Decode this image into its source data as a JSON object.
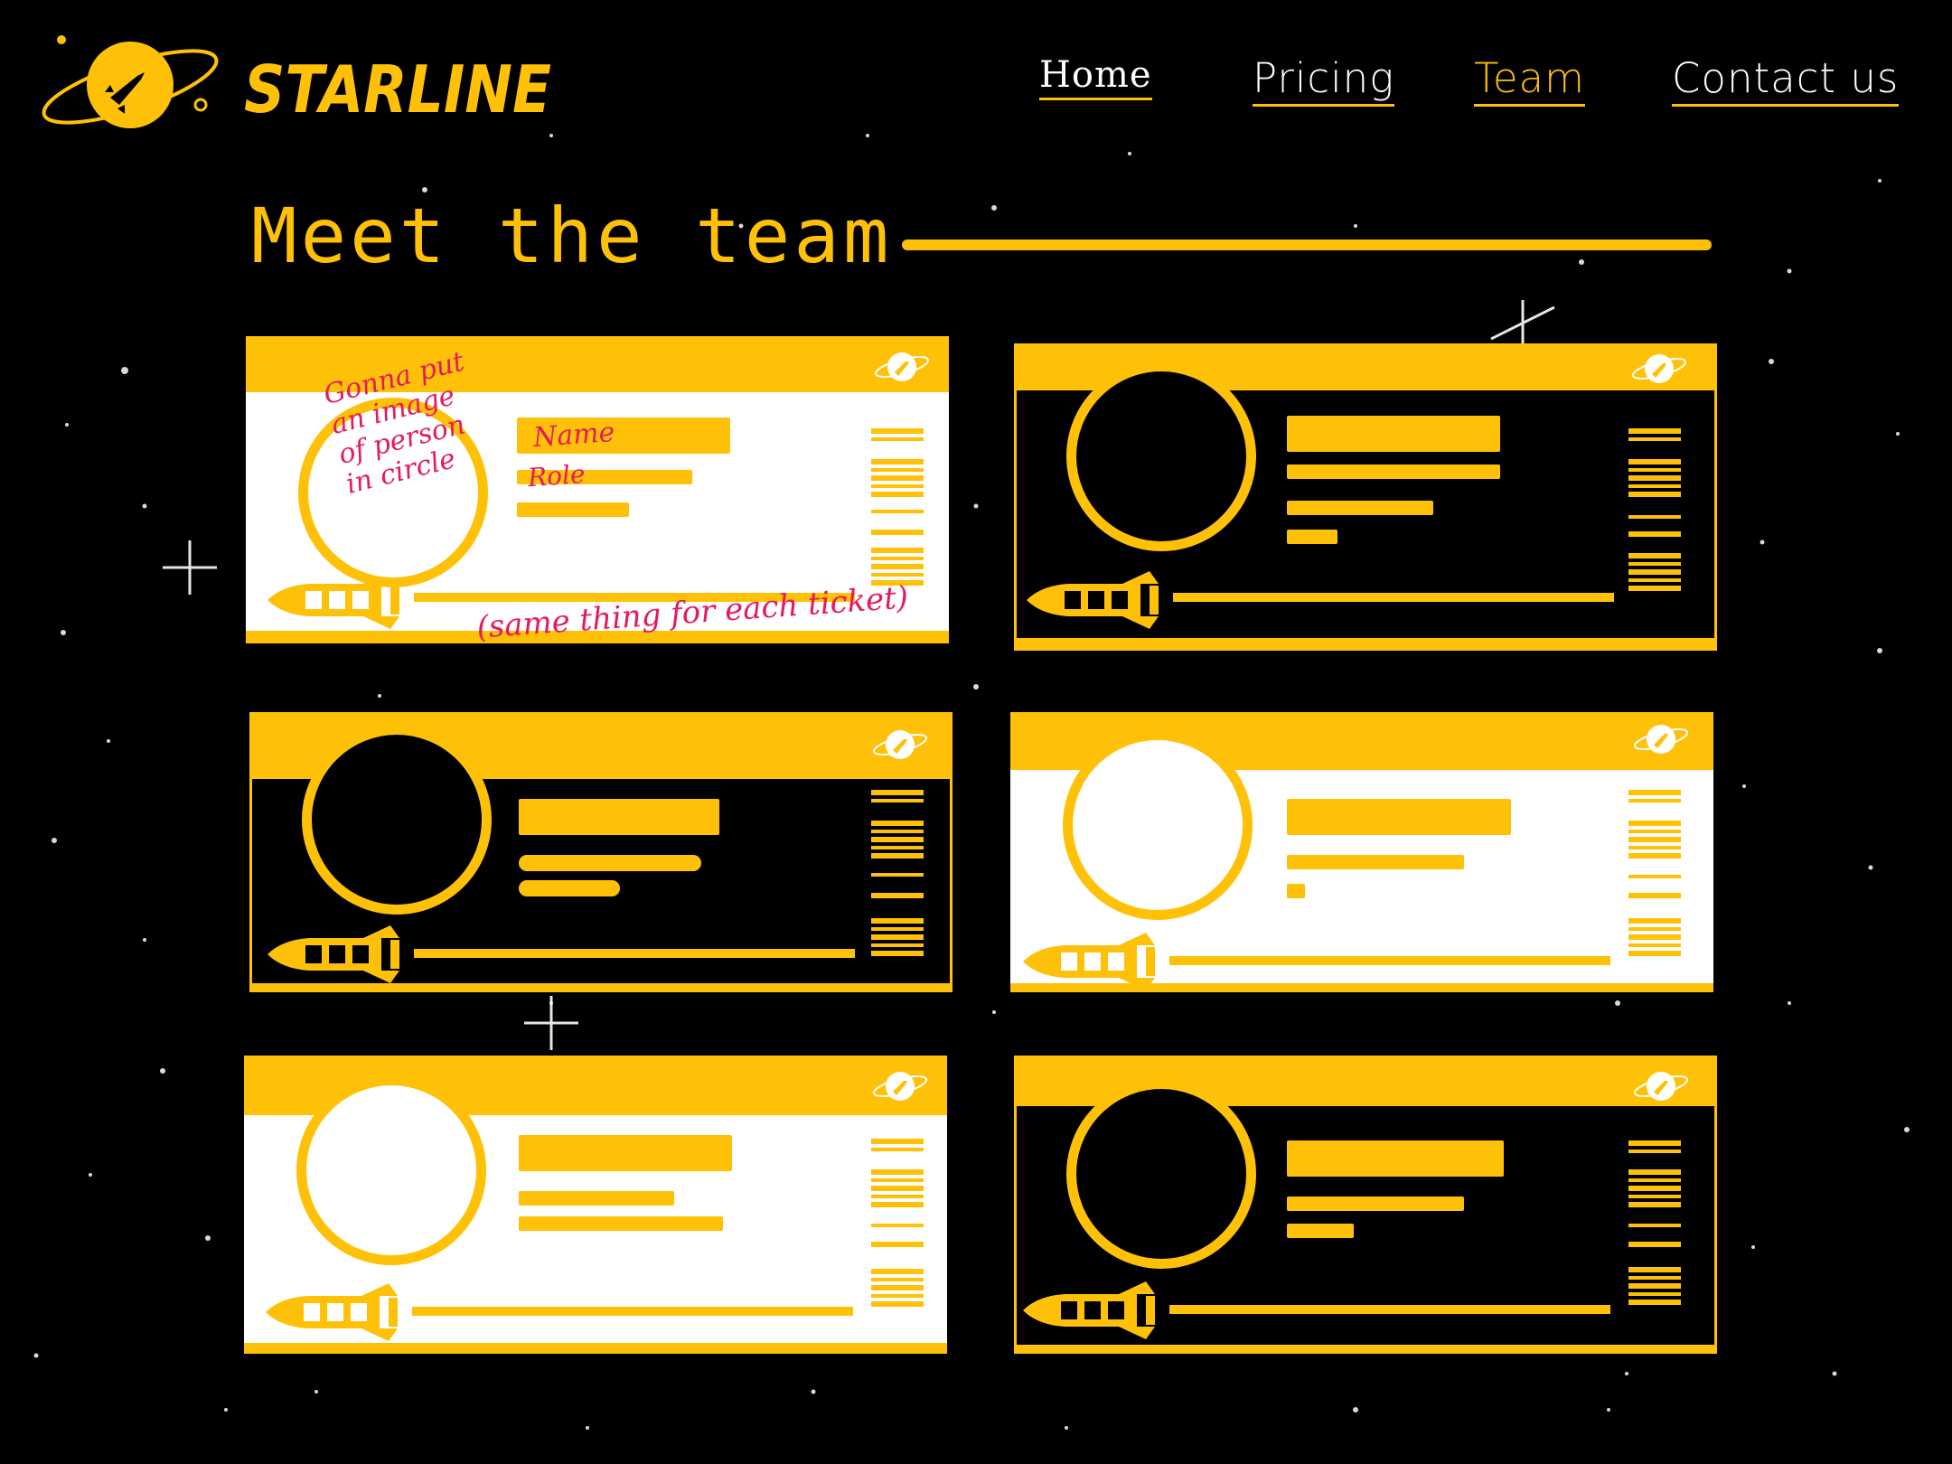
{
  "brand": {
    "name": "STARLINE",
    "colors": {
      "accent": "#FFC107",
      "background": "#000000",
      "ticket_light": "#FFFFFF",
      "annotation": "#E6195F"
    },
    "icon": "rocket-planet-icon"
  },
  "nav": {
    "items": [
      {
        "id": "home",
        "label": "Home",
        "active": false
      },
      {
        "id": "pricing",
        "label": "Pricing",
        "active": false
      },
      {
        "id": "team",
        "label": "Team",
        "active": true
      },
      {
        "id": "contact",
        "label": "Contact us",
        "active": false
      }
    ]
  },
  "page": {
    "title": "Meet the team"
  },
  "tickets": [
    {
      "theme": "white",
      "icon": "rocket-icon"
    },
    {
      "theme": "black",
      "icon": "rocket-icon"
    },
    {
      "theme": "black",
      "icon": "rocket-icon"
    },
    {
      "theme": "white",
      "icon": "rocket-icon"
    },
    {
      "theme": "white",
      "icon": "rocket-icon"
    },
    {
      "theme": "black",
      "icon": "rocket-icon"
    }
  ],
  "annotations": {
    "image_note": [
      "Gonna put",
      "an image",
      "of person",
      "in circle"
    ],
    "name_note": "Name",
    "role_note": "Role",
    "each_note": "(same thing for each ticket)"
  }
}
